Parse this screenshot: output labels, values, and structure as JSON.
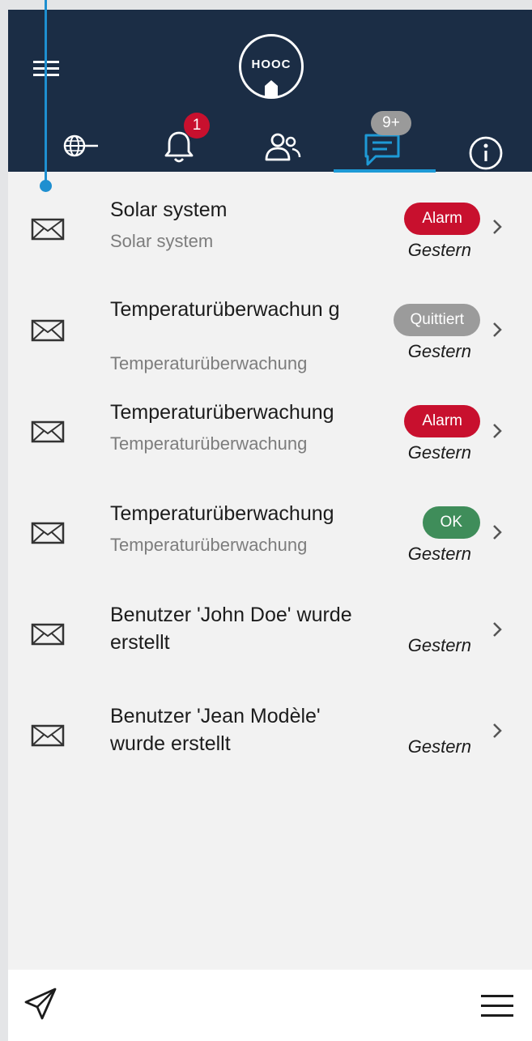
{
  "header": {
    "logo_text": "HOOC",
    "tabs": [
      {
        "icon": "globe-icon"
      },
      {
        "icon": "bell-icon",
        "badge": "1"
      },
      {
        "icon": "users-icon"
      },
      {
        "icon": "chat-icon",
        "badge": "9+",
        "active": true
      },
      {
        "icon": "info-icon"
      }
    ]
  },
  "messages": [
    {
      "title": "Solar system",
      "subtitle": "Solar system",
      "status": "Alarm",
      "date": "Gestern"
    },
    {
      "title": "Temperaturüberwachun g",
      "subtitle": "Temperaturüberwachung",
      "status": "Quittiert",
      "date": "Gestern"
    },
    {
      "title": "Temperaturüberwachung",
      "subtitle": "Temperaturüberwachung",
      "status": "Alarm",
      "date": "Gestern"
    },
    {
      "title": "Temperaturüberwachung",
      "subtitle": "Temperaturüberwachung",
      "status": "OK",
      "date": "Gestern"
    },
    {
      "title": "Benutzer 'John Doe' wurde erstellt",
      "subtitle": "",
      "status": "",
      "date": "Gestern"
    },
    {
      "title": "Benutzer 'Jean Modèle' wurde erstellt",
      "subtitle": "",
      "status": "",
      "date": "Gestern"
    }
  ],
  "colors": {
    "header_bg": "#1b2d45",
    "accent": "#1e9ad6",
    "alarm": "#c8102e",
    "acknowledged": "#9b9b9b",
    "ok": "#3f8d5a"
  }
}
